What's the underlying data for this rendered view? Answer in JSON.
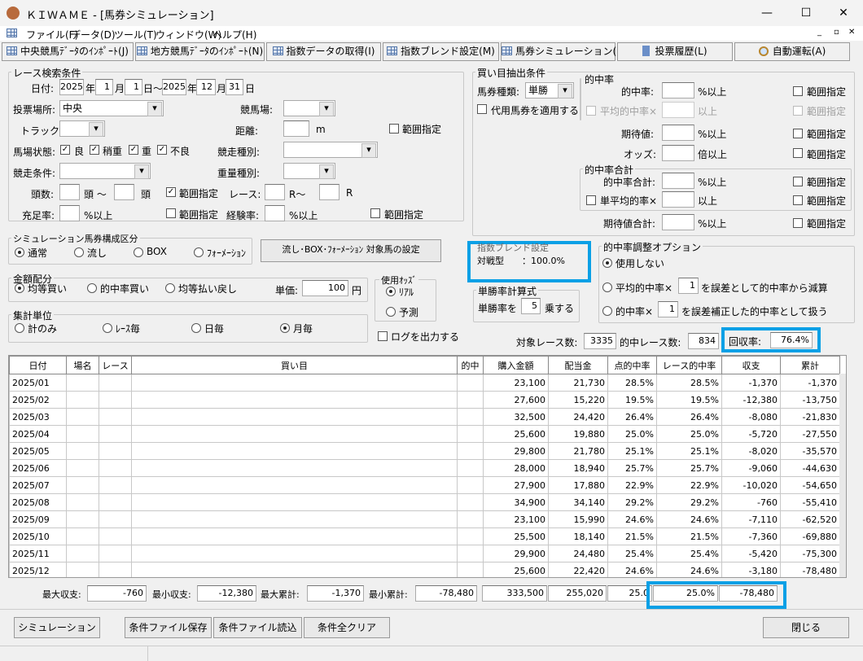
{
  "window": {
    "title": "ＫＩＷＡＭＥ - [馬券シミュレーション]",
    "minimize": "—",
    "maximize": "☐",
    "close": "✕"
  },
  "menu": [
    "ファイル(F)",
    "データ(D)",
    "ツール(T)",
    "ウィンドウ(W)",
    "ヘルプ(H)"
  ],
  "mdi_controls": [
    "_",
    "▫",
    "✕"
  ],
  "toolbar": [
    "中央競馬ﾃﾞｰﾀのｲﾝﾎﾟｰﾄ(J)",
    "地方競馬ﾃﾞｰﾀのｲﾝﾎﾟｰﾄ(N)",
    "指数データの取得(I)",
    "指数ブレンド設定(M)",
    "馬券シミュレーション(B)",
    "投票履歴(L)",
    "自動運転(A)"
  ],
  "race": {
    "title": "レース検索条件",
    "date_label": "日付:",
    "from_year": "2025",
    "from_month": "1",
    "from_day": "1",
    "to_year": "2025",
    "to_month": "12",
    "to_day": "31",
    "nen": "年",
    "gatsu": "月",
    "nichi": "日",
    "nichi_kara": "日～",
    "venue_label": "投票場所:",
    "venue": "中央",
    "course_label": "競馬場:",
    "track_label": "トラック:",
    "distance_label": "距離:",
    "m": "m",
    "range": "範囲指定",
    "condition_label": "馬場状態:",
    "conditions": [
      "良",
      "稍重",
      "重",
      "不良"
    ],
    "race_type_label": "競走種別:",
    "race_cond_label": "競走条件:",
    "weight_label": "重量種別:",
    "heads_label": "頭数:",
    "tou_kara": "頭 ～",
    "tou": "頭",
    "race_no_label": "レース:",
    "r_kara": "R～",
    "r": "R",
    "fill_label": "充足率:",
    "pct_over": "%以上",
    "exp_label": "経験率:"
  },
  "sim": {
    "title": "シミュレーション馬券構成区分",
    "options": [
      "通常",
      "流し",
      "BOX",
      "ﾌｫｰﾒｰｼｮﾝ"
    ],
    "selected": 0,
    "target_button": "流し･BOX･ﾌｫｰﾒｰｼｮﾝ 対象馬の設定"
  },
  "amount": {
    "title": "金額配分",
    "options": [
      "均等買い",
      "的中率買い",
      "均等払い戻し"
    ],
    "selected": 0,
    "unit_label": "単価:",
    "unit": "100",
    "yen": "円"
  },
  "odds": {
    "title": "使用ｵｯｽﾞ",
    "options": [
      "ﾘｱﾙ",
      "予測"
    ],
    "selected": 0
  },
  "agg": {
    "title": "集計単位",
    "options": [
      "計のみ",
      "ﾚｰｽ毎",
      "日毎",
      "月毎"
    ],
    "selected": 3
  },
  "log_label": "ログを出力する",
  "buy": {
    "title": "買い目抽出条件",
    "type_label": "馬券種類:",
    "type": "単勝",
    "substitute": "代用馬券を適用する",
    "hit_group": "的中率",
    "hit_label": "的中率:",
    "pct_over": "%以上",
    "avg_hit_label": "平均的中率×",
    "over": "以上",
    "range": "範囲指定",
    "ev_label": "期待値:",
    "odds_label": "オッズ:",
    "odds_over": "倍以上",
    "sum_group": "的中率合計",
    "sum_label": "的中率合計:",
    "single_avg": "単平均的率×",
    "ev_sum_label": "期待値合計:"
  },
  "blend": {
    "title": "指数ブレンド設定",
    "line": "対戦型　　：100.0%"
  },
  "win_calc": {
    "title": "単勝率計算式",
    "prefix": "単勝率を",
    "value": "5",
    "suffix": "乗する"
  },
  "adjust": {
    "title": "的中率調整オプション",
    "opt0": "使用しない",
    "opt1_pre": "平均的中率×",
    "opt1_val": "1",
    "opt1_post": "を誤差として的中率から減算",
    "opt2_pre": "的中率×",
    "opt2_val": "1",
    "opt2_post": "を誤差補正した的中率として扱う",
    "selected": 0
  },
  "counts": {
    "target_label": "対象レース数:",
    "target": "3335",
    "hit_label": "的中レース数:",
    "hit": "834",
    "return_label": "回収率:",
    "return": "76.4%"
  },
  "table": {
    "headers": [
      "日付",
      "場名",
      "レース",
      "買い目",
      "的中",
      "購入金額",
      "配当金",
      "点的中率",
      "レース的中率",
      "収支",
      "累計"
    ],
    "rows": [
      [
        "2025/01",
        "",
        "",
        "",
        "",
        "23,100",
        "21,730",
        "28.5%",
        "28.5%",
        "-1,370",
        "-1,370"
      ],
      [
        "2025/02",
        "",
        "",
        "",
        "",
        "27,600",
        "15,220",
        "19.5%",
        "19.5%",
        "-12,380",
        "-13,750"
      ],
      [
        "2025/03",
        "",
        "",
        "",
        "",
        "32,500",
        "24,420",
        "26.4%",
        "26.4%",
        "-8,080",
        "-21,830"
      ],
      [
        "2025/04",
        "",
        "",
        "",
        "",
        "25,600",
        "19,880",
        "25.0%",
        "25.0%",
        "-5,720",
        "-27,550"
      ],
      [
        "2025/05",
        "",
        "",
        "",
        "",
        "29,800",
        "21,780",
        "25.1%",
        "25.1%",
        "-8,020",
        "-35,570"
      ],
      [
        "2025/06",
        "",
        "",
        "",
        "",
        "28,000",
        "18,940",
        "25.7%",
        "25.7%",
        "-9,060",
        "-44,630"
      ],
      [
        "2025/07",
        "",
        "",
        "",
        "",
        "27,900",
        "17,880",
        "22.9%",
        "22.9%",
        "-10,020",
        "-54,650"
      ],
      [
        "2025/08",
        "",
        "",
        "",
        "",
        "34,900",
        "34,140",
        "29.2%",
        "29.2%",
        "-760",
        "-55,410"
      ],
      [
        "2025/09",
        "",
        "",
        "",
        "",
        "23,100",
        "15,990",
        "24.6%",
        "24.6%",
        "-7,110",
        "-62,520"
      ],
      [
        "2025/10",
        "",
        "",
        "",
        "",
        "25,500",
        "18,140",
        "21.5%",
        "21.5%",
        "-7,360",
        "-69,880"
      ],
      [
        "2025/11",
        "",
        "",
        "",
        "",
        "29,900",
        "24,480",
        "25.4%",
        "25.4%",
        "-5,420",
        "-75,300"
      ],
      [
        "2025/12",
        "",
        "",
        "",
        "",
        "25,600",
        "22,420",
        "24.6%",
        "24.6%",
        "-3,180",
        "-78,480"
      ]
    ]
  },
  "summary": {
    "max_label": "最大収支:",
    "max": "-760",
    "min_label": "最小収支:",
    "min": "-12,380",
    "max_cum_label": "最大累計:",
    "max_cum": "-1,370",
    "min_cum_label": "最小累計:",
    "min_cum": "-78,480",
    "total_buy": "333,500",
    "total_pay": "255,020",
    "point_hit": "25.0",
    "race_hit": "25.0%",
    "total": "-78,480"
  },
  "buttons": {
    "simulate": "シミュレーション",
    "save": "条件ファイル保存",
    "load": "条件ファイル読込",
    "clear": "条件全クリア",
    "close": "閉じる"
  },
  "colors": {
    "highlight": "#0aa0e6"
  }
}
